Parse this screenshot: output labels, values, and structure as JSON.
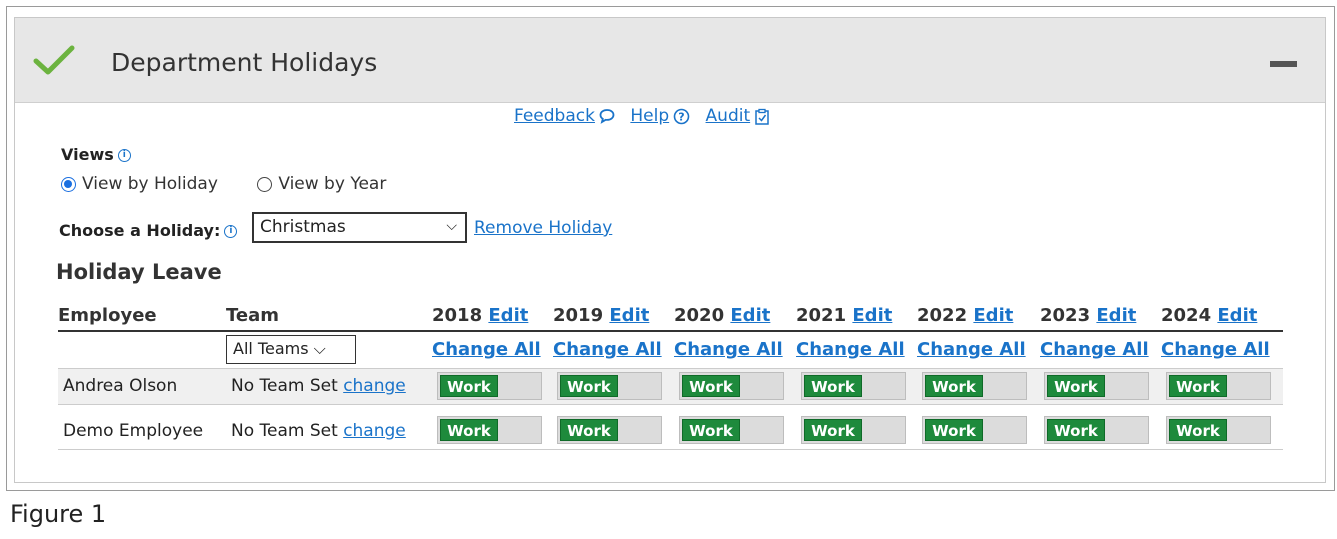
{
  "panel": {
    "title": "Department Holidays"
  },
  "links": {
    "feedback": "Feedback",
    "help": "Help",
    "audit": "Audit"
  },
  "views": {
    "label": "Views",
    "options": [
      "View by Holiday",
      "View by Year"
    ],
    "selected": "View by Holiday"
  },
  "holiday": {
    "label": "Choose a Holiday:",
    "selected": "Christmas",
    "remove": "Remove Holiday"
  },
  "section": {
    "title": "Holiday Leave"
  },
  "table": {
    "col_employee": "Employee",
    "col_team": "Team",
    "team_filter": "All Teams",
    "years": [
      "2018",
      "2019",
      "2020",
      "2021",
      "2022",
      "2023",
      "2024"
    ],
    "edit": "Edit",
    "change_all": "Change All",
    "rows": [
      {
        "name": "Andrea Olson",
        "team": "No Team Set",
        "change": "change",
        "status": "Work"
      },
      {
        "name": "Demo Employee",
        "team": "No Team Set",
        "change": "change",
        "status": "Work"
      }
    ]
  },
  "caption": "Figure 1",
  "colors": {
    "accent": "#1a73c9",
    "work_green": "#1e8a3c",
    "check_green": "#6cb33f"
  }
}
